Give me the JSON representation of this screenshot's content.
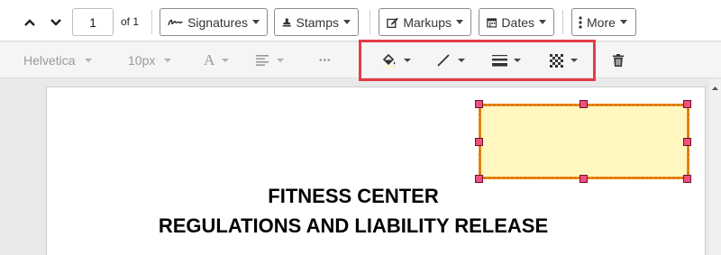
{
  "toolbar": {
    "page_value": "1",
    "page_total": "of 1",
    "signatures_label": "Signatures",
    "stamps_label": "Stamps",
    "markups_label": "Markups",
    "dates_label": "Dates",
    "more_label": "More"
  },
  "format_bar": {
    "font_family": "Helvetica",
    "font_size": "10px",
    "text_style_glyph": "A",
    "more_glyph": "•••"
  },
  "document": {
    "title_line1": "FITNESS CENTER",
    "title_line2": "REGULATIONS AND LIABILITY RELEASE"
  },
  "annotation": {
    "fill_color": "#fff7bf",
    "border_color": "#f08c16",
    "handle_color": "#ef4f7c"
  },
  "highlight_color": "#e53b47"
}
